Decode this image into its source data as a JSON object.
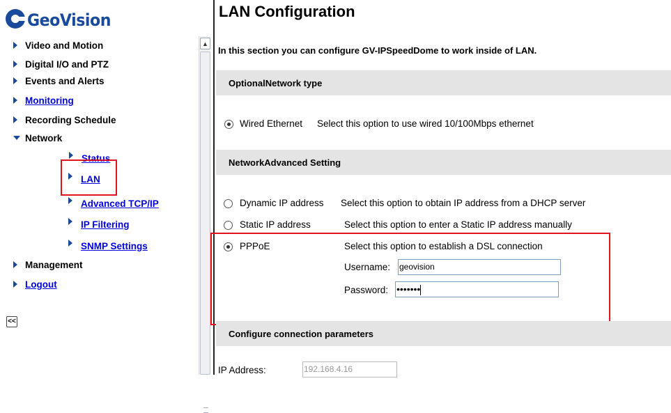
{
  "logo": {
    "text": "GeoVision"
  },
  "sidebar": {
    "items": [
      {
        "label": "Video and Motion"
      },
      {
        "label": "Digital I/O and PTZ"
      },
      {
        "label": "Events and Alerts"
      },
      {
        "label": "Monitoring"
      },
      {
        "label": "Recording Schedule"
      },
      {
        "label": "Network"
      },
      {
        "label": "Management"
      },
      {
        "label": "Logout"
      }
    ],
    "network_sub": [
      {
        "label": "Status"
      },
      {
        "label": "LAN"
      },
      {
        "label": "Advanced TCP/IP"
      },
      {
        "label": "IP Filtering"
      },
      {
        "label": "SNMP Settings"
      }
    ],
    "collapse_label": "<<"
  },
  "main": {
    "title": "LAN Configuration",
    "intro": "In this section you can configure GV-IPSpeedDome to work inside of LAN.",
    "sections": {
      "optional_network": "OptionalNetwork type",
      "advanced_setting": "NetworkAdvanced Setting",
      "connection_params": "Configure connection parameters"
    },
    "wired": {
      "label": "Wired Ethernet",
      "desc": "Select this option to use wired 10/100Mbps ethernet",
      "checked": true
    },
    "ip_options": [
      {
        "label": "Dynamic IP address",
        "desc": "Select this option to obtain IP address from a DHCP server",
        "checked": false
      },
      {
        "label": "Static IP address",
        "desc": "Select this option to enter a Static IP address manually",
        "checked": false
      },
      {
        "label": "PPPoE",
        "desc": "Select this option to establish a DSL connection",
        "checked": true
      }
    ],
    "pppoe": {
      "username_label": "Username:",
      "username_value": "geovision",
      "password_label": "Password:",
      "password_value": "•••••••"
    },
    "ip_address": {
      "label": "IP Address:",
      "value": "192.168.4.16"
    }
  },
  "colors": {
    "highlight": "#e0141e",
    "link": "#0000e0",
    "brand": "#1a4a9c",
    "section_bg": "#e4e4e4"
  }
}
